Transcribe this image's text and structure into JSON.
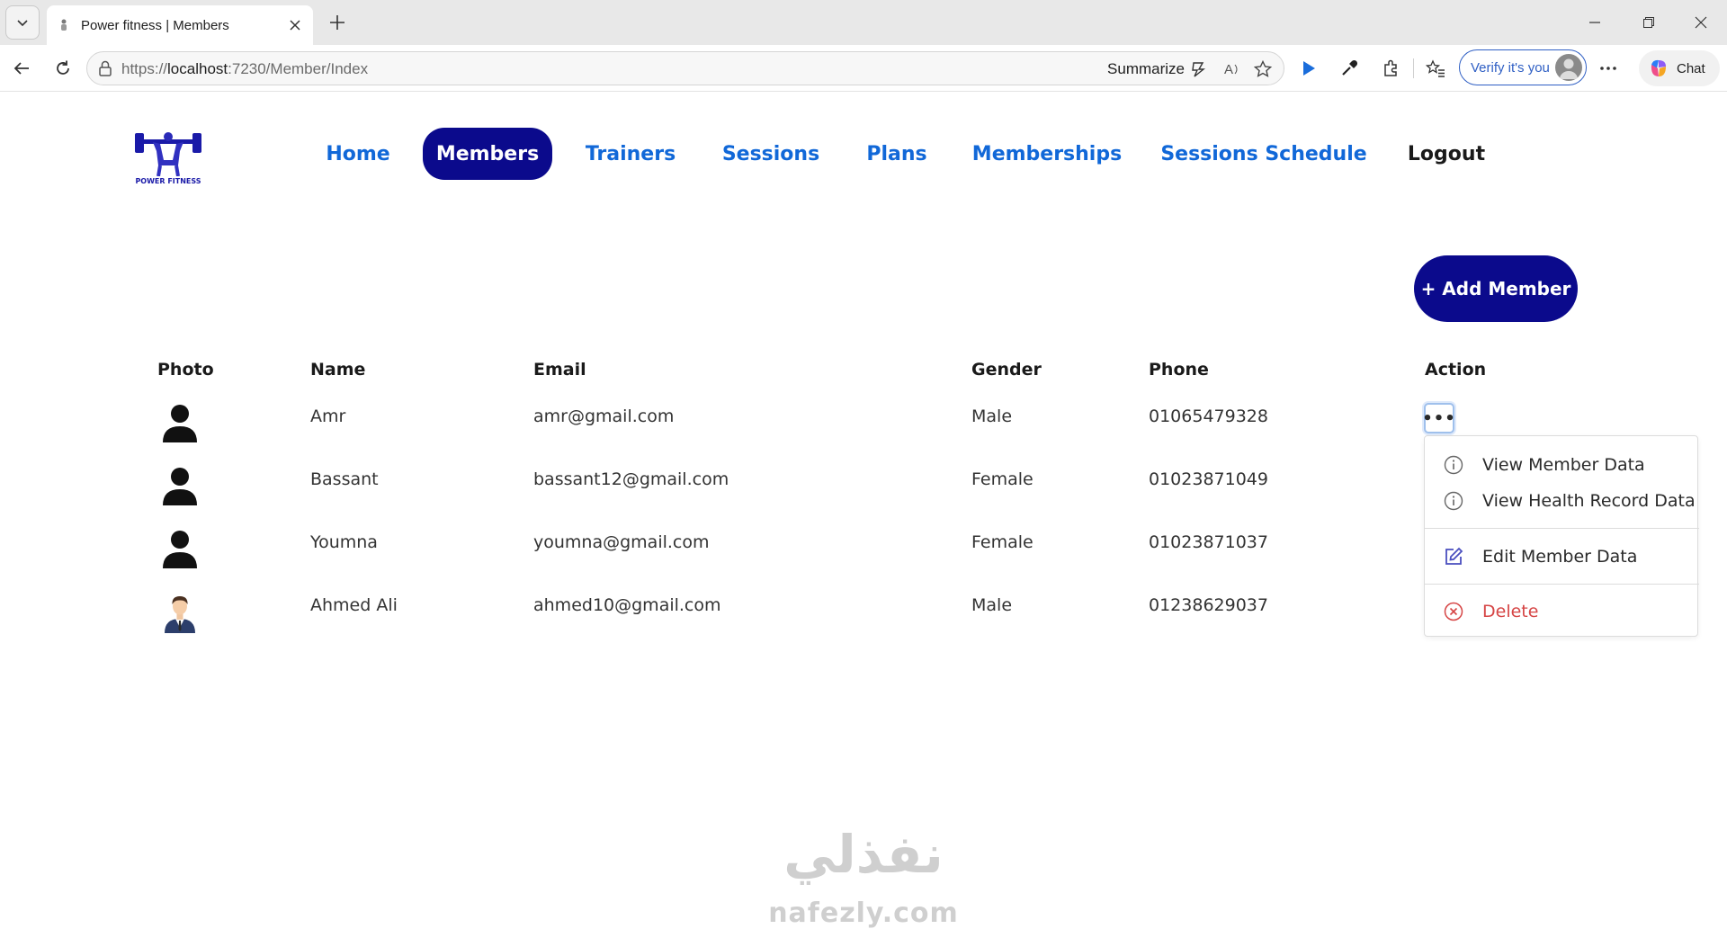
{
  "browser": {
    "tab_title": "Power fitness | Members",
    "url_scheme": "https://",
    "url_host": "localhost",
    "url_path": ":7230/Member/Index",
    "summarize_label": "Summarize",
    "verify_label": "Verify it's you",
    "chat_label": "Chat"
  },
  "nav": {
    "items": [
      {
        "label": "Home"
      },
      {
        "label": "Members"
      },
      {
        "label": "Trainers"
      },
      {
        "label": "Sessions"
      },
      {
        "label": "Plans"
      },
      {
        "label": "Memberships"
      },
      {
        "label": "Sessions Schedule"
      },
      {
        "label": "Logout"
      }
    ],
    "active": "Members"
  },
  "add_member_label": "+ Add Member",
  "table": {
    "headers": [
      "Photo",
      "Name",
      "Email",
      "Gender",
      "Phone",
      "Action"
    ],
    "rows": [
      {
        "name": "Amr",
        "email": "amr@gmail.com",
        "gender": "Male",
        "phone": "01065479328"
      },
      {
        "name": "Bassant",
        "email": "bassant12@gmail.com",
        "gender": "Female",
        "phone": "01023871049"
      },
      {
        "name": "Youmna",
        "email": "youmna@gmail.com",
        "gender": "Female",
        "phone": "01023871037"
      },
      {
        "name": "Ahmed Ali",
        "email": "ahmed10@gmail.com",
        "gender": "Male",
        "phone": "01238629037"
      }
    ]
  },
  "action_menu": {
    "trigger": "•••",
    "view_member": "View Member Data",
    "view_health": "View Health Record Data",
    "edit_member": "Edit Member Data",
    "delete": "Delete"
  },
  "watermark": {
    "latin": "nafezly.com",
    "arabic": "نفذلي"
  },
  "colors": {
    "brand_navy": "#0b0a8c",
    "nav_link": "#1168d8",
    "danger": "#d64545"
  }
}
